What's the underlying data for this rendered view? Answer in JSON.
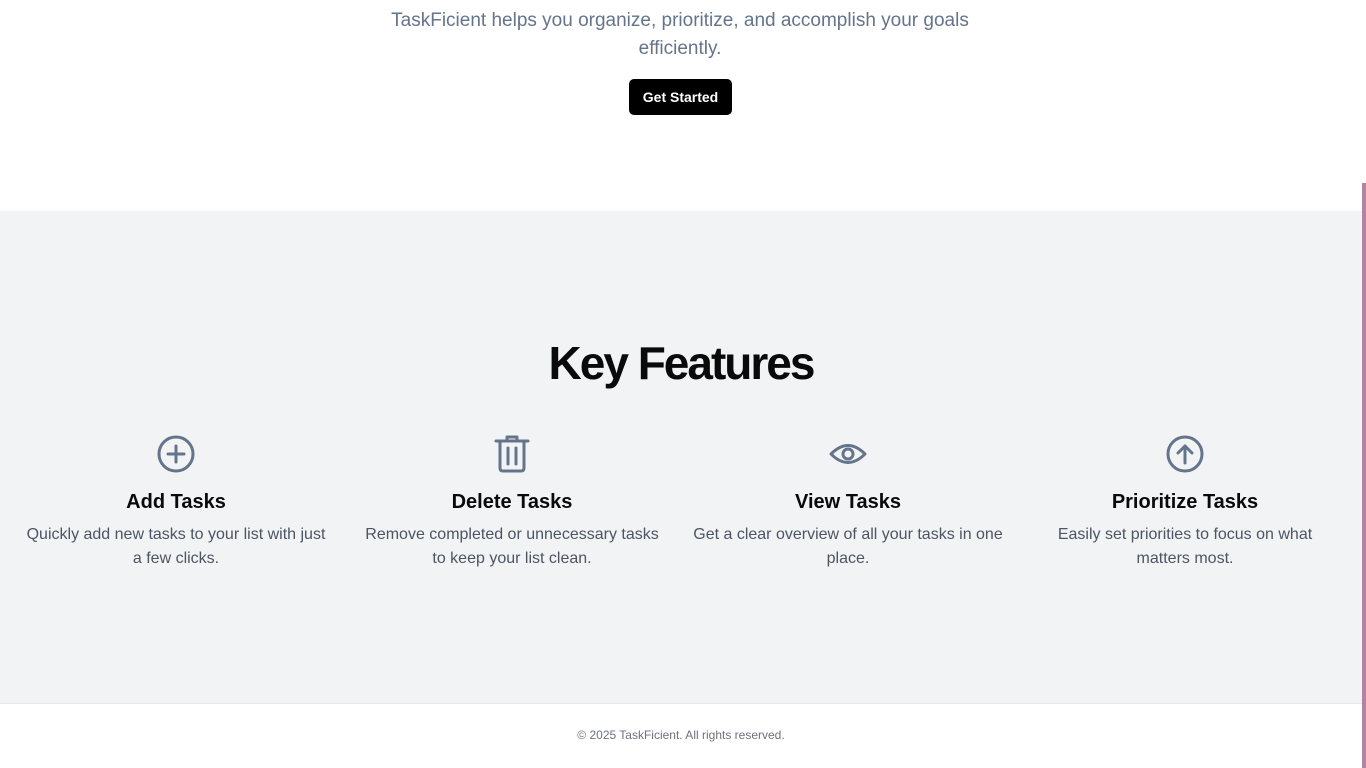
{
  "hero": {
    "subtitle": "TaskFicient helps you organize, prioritize, and accomplish your goals efficiently.",
    "cta_label": "Get Started"
  },
  "features": {
    "title": "Key Features",
    "items": [
      {
        "icon": "plus-circle-icon",
        "title": "Add Tasks",
        "description": "Quickly add new tasks to your list with just a few clicks."
      },
      {
        "icon": "trash-icon",
        "title": "Delete Tasks",
        "description": "Remove completed or unnecessary tasks to keep your list clean."
      },
      {
        "icon": "eye-icon",
        "title": "View Tasks",
        "description": "Get a clear overview of all your tasks in one place."
      },
      {
        "icon": "arrow-up-circle-icon",
        "title": "Prioritize Tasks",
        "description": "Easily set priorities to focus on what matters most."
      }
    ]
  },
  "footer": {
    "copyright": "© 2025 TaskFicient. All rights reserved."
  },
  "colors": {
    "icon": "#64748b",
    "cta_bg": "#000000",
    "section_bg": "#f2f3f5",
    "scrollbar_thumb": "#b184a4"
  }
}
